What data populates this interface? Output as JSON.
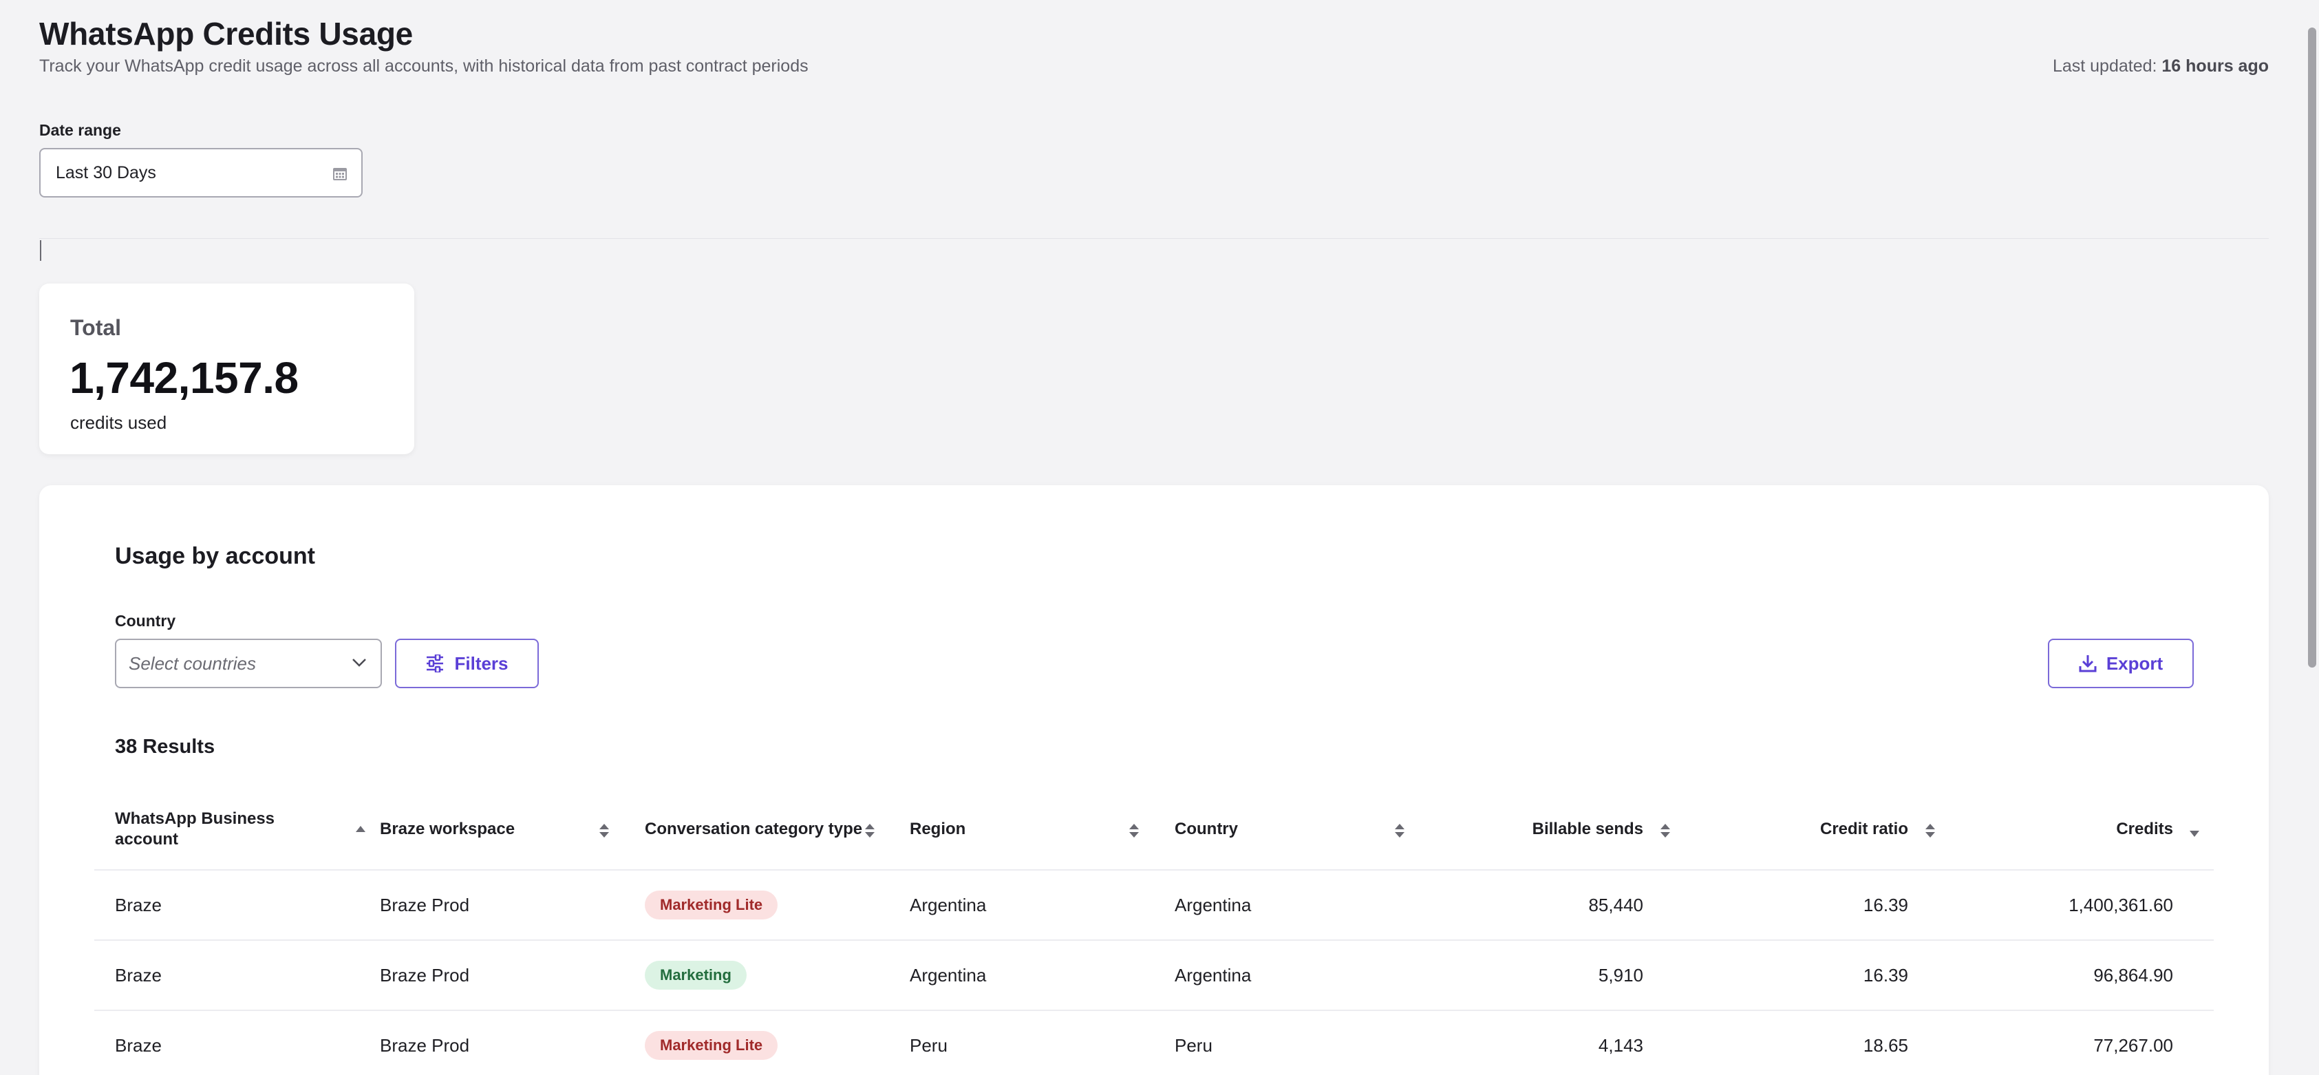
{
  "header": {
    "title": "WhatsApp Credits Usage",
    "subtitle": "Track your WhatsApp credit usage across all accounts, with historical data from past contract periods",
    "last_updated_label": "Last updated:",
    "last_updated_value": "16 hours ago"
  },
  "date_range": {
    "label": "Date range",
    "value": "Last 30 Days",
    "icon": "calendar-icon"
  },
  "total": {
    "label": "Total",
    "value": "1,742,157.8",
    "unit": "credits used"
  },
  "usage": {
    "title": "Usage by account",
    "country_label": "Country",
    "country_placeholder": "Select countries",
    "filters_label": "Filters",
    "export_label": "Export",
    "results": "38 Results",
    "columns": [
      {
        "label": "WhatsApp Business account",
        "sort": "asc"
      },
      {
        "label": "Braze workspace",
        "sort": "none"
      },
      {
        "label": "Conversation category type",
        "sort": "none"
      },
      {
        "label": "Region",
        "sort": "none"
      },
      {
        "label": "Country",
        "sort": "none"
      },
      {
        "label": "Billable sends",
        "sort": "none"
      },
      {
        "label": "Credit ratio",
        "sort": "none"
      },
      {
        "label": "Credits",
        "sort": "desc"
      }
    ],
    "rows": [
      {
        "account": "Braze",
        "workspace": "Braze Prod",
        "category": "Marketing Lite",
        "category_style": "lite",
        "region": "Argentina",
        "country": "Argentina",
        "sends": "85,440",
        "ratio": "16.39",
        "credits": "1,400,361.60"
      },
      {
        "account": "Braze",
        "workspace": "Braze Prod",
        "category": "Marketing",
        "category_style": "mkt",
        "region": "Argentina",
        "country": "Argentina",
        "sends": "5,910",
        "ratio": "16.39",
        "credits": "96,864.90"
      },
      {
        "account": "Braze",
        "workspace": "Braze Prod",
        "category": "Marketing Lite",
        "category_style": "lite",
        "region": "Peru",
        "country": "Peru",
        "sends": "4,143",
        "ratio": "18.65",
        "credits": "77,267.00"
      }
    ]
  },
  "colors": {
    "accent": "#5a3fd6",
    "badge_lite_bg": "#fbe1e1",
    "badge_lite_fg": "#a02a2a",
    "badge_mkt_bg": "#dcf3e4",
    "badge_mkt_fg": "#236d3e"
  }
}
